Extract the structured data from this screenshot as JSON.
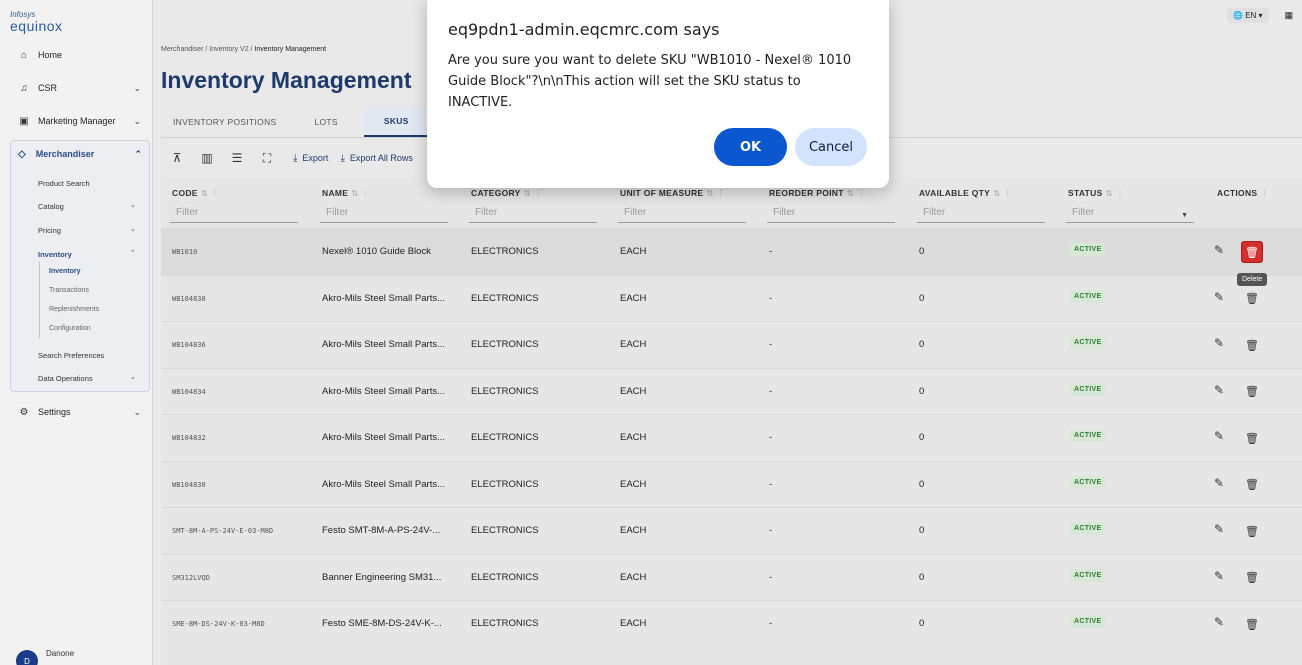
{
  "logo": {
    "line1": "Infosys",
    "line2": "equinox"
  },
  "sidebar": {
    "home": "Home",
    "csr": "CSR",
    "marketing": "Marketing Manager",
    "merchandiser": "Merchandiser",
    "sub": {
      "product_search": "Product Search",
      "catalog": "Catalog",
      "pricing": "Pricing",
      "inventory": "Inventory",
      "inventory_sub": [
        "Inventory",
        "Transactions",
        "Replenishments",
        "Configuration"
      ],
      "search_prefs": "Search Preferences",
      "data_ops": "Data Operations"
    },
    "settings": "Settings",
    "user_initial": "D",
    "user_name": "Danone"
  },
  "topbar": {
    "lang": "EN"
  },
  "breadcrumb": {
    "a": "Merchandiser",
    "b": "Inventory V2",
    "c": "Inventory Management",
    "sep": "/"
  },
  "page_title": "Inventory Management",
  "tabs": [
    "INVENTORY POSITIONS",
    "LOTS",
    "SKUS"
  ],
  "toolbar": {
    "export": "Export",
    "export_all": "Export All Rows"
  },
  "columns": {
    "code": "CODE",
    "name": "NAME",
    "category": "CATEGORY",
    "uom": "UNIT OF MEASURE",
    "reorder": "REORDER POINT",
    "available": "AVAILABLE QTY",
    "status": "STATUS",
    "actions": "ACTIONS"
  },
  "filter_placeholder": "Filter",
  "rows": [
    {
      "code": "WB1010",
      "name": "Nexel® 1010 Guide Block",
      "category": "ELECTRONICS",
      "uom": "EACH",
      "reorder": "-",
      "qty": "0",
      "status": "ACTIVE"
    },
    {
      "code": "WB104838",
      "name": "Akro-Mils Steel Small Parts...",
      "category": "ELECTRONICS",
      "uom": "EACH",
      "reorder": "-",
      "qty": "0",
      "status": "ACTIVE"
    },
    {
      "code": "WB104836",
      "name": "Akro-Mils Steel Small Parts...",
      "category": "ELECTRONICS",
      "uom": "EACH",
      "reorder": "-",
      "qty": "0",
      "status": "ACTIVE"
    },
    {
      "code": "WB104834",
      "name": "Akro-Mils Steel Small Parts...",
      "category": "ELECTRONICS",
      "uom": "EACH",
      "reorder": "-",
      "qty": "0",
      "status": "ACTIVE"
    },
    {
      "code": "WB104832",
      "name": "Akro-Mils Steel Small Parts...",
      "category": "ELECTRONICS",
      "uom": "EACH",
      "reorder": "-",
      "qty": "0",
      "status": "ACTIVE"
    },
    {
      "code": "WB104830",
      "name": "Akro-Mils Steel Small Parts...",
      "category": "ELECTRONICS",
      "uom": "EACH",
      "reorder": "-",
      "qty": "0",
      "status": "ACTIVE"
    },
    {
      "code": "SMT-8M-A-PS-24V-E-03-M8D",
      "name": "Festo SMT-8M-A-PS-24V-...",
      "category": "ELECTRONICS",
      "uom": "EACH",
      "reorder": "-",
      "qty": "0",
      "status": "ACTIVE"
    },
    {
      "code": "SM312LVQD",
      "name": "Banner Engineering SM31...",
      "category": "ELECTRONICS",
      "uom": "EACH",
      "reorder": "-",
      "qty": "0",
      "status": "ACTIVE"
    },
    {
      "code": "SME-8M-DS-24V-K-03-M8D",
      "name": "Festo SME-8M-DS-24V-K-...",
      "category": "ELECTRONICS",
      "uom": "EACH",
      "reorder": "-",
      "qty": "0",
      "status": "ACTIVE"
    }
  ],
  "tooltip": "Delete",
  "dialog": {
    "title": "eq9pdn1-admin.eqcmrc.com says",
    "message": "Are you sure you want to delete SKU \"WB1010 - Nexel® 1010 Guide Block\"?\\n\\nThis action will set the SKU status to INACTIVE.",
    "ok": "OK",
    "cancel": "Cancel"
  }
}
